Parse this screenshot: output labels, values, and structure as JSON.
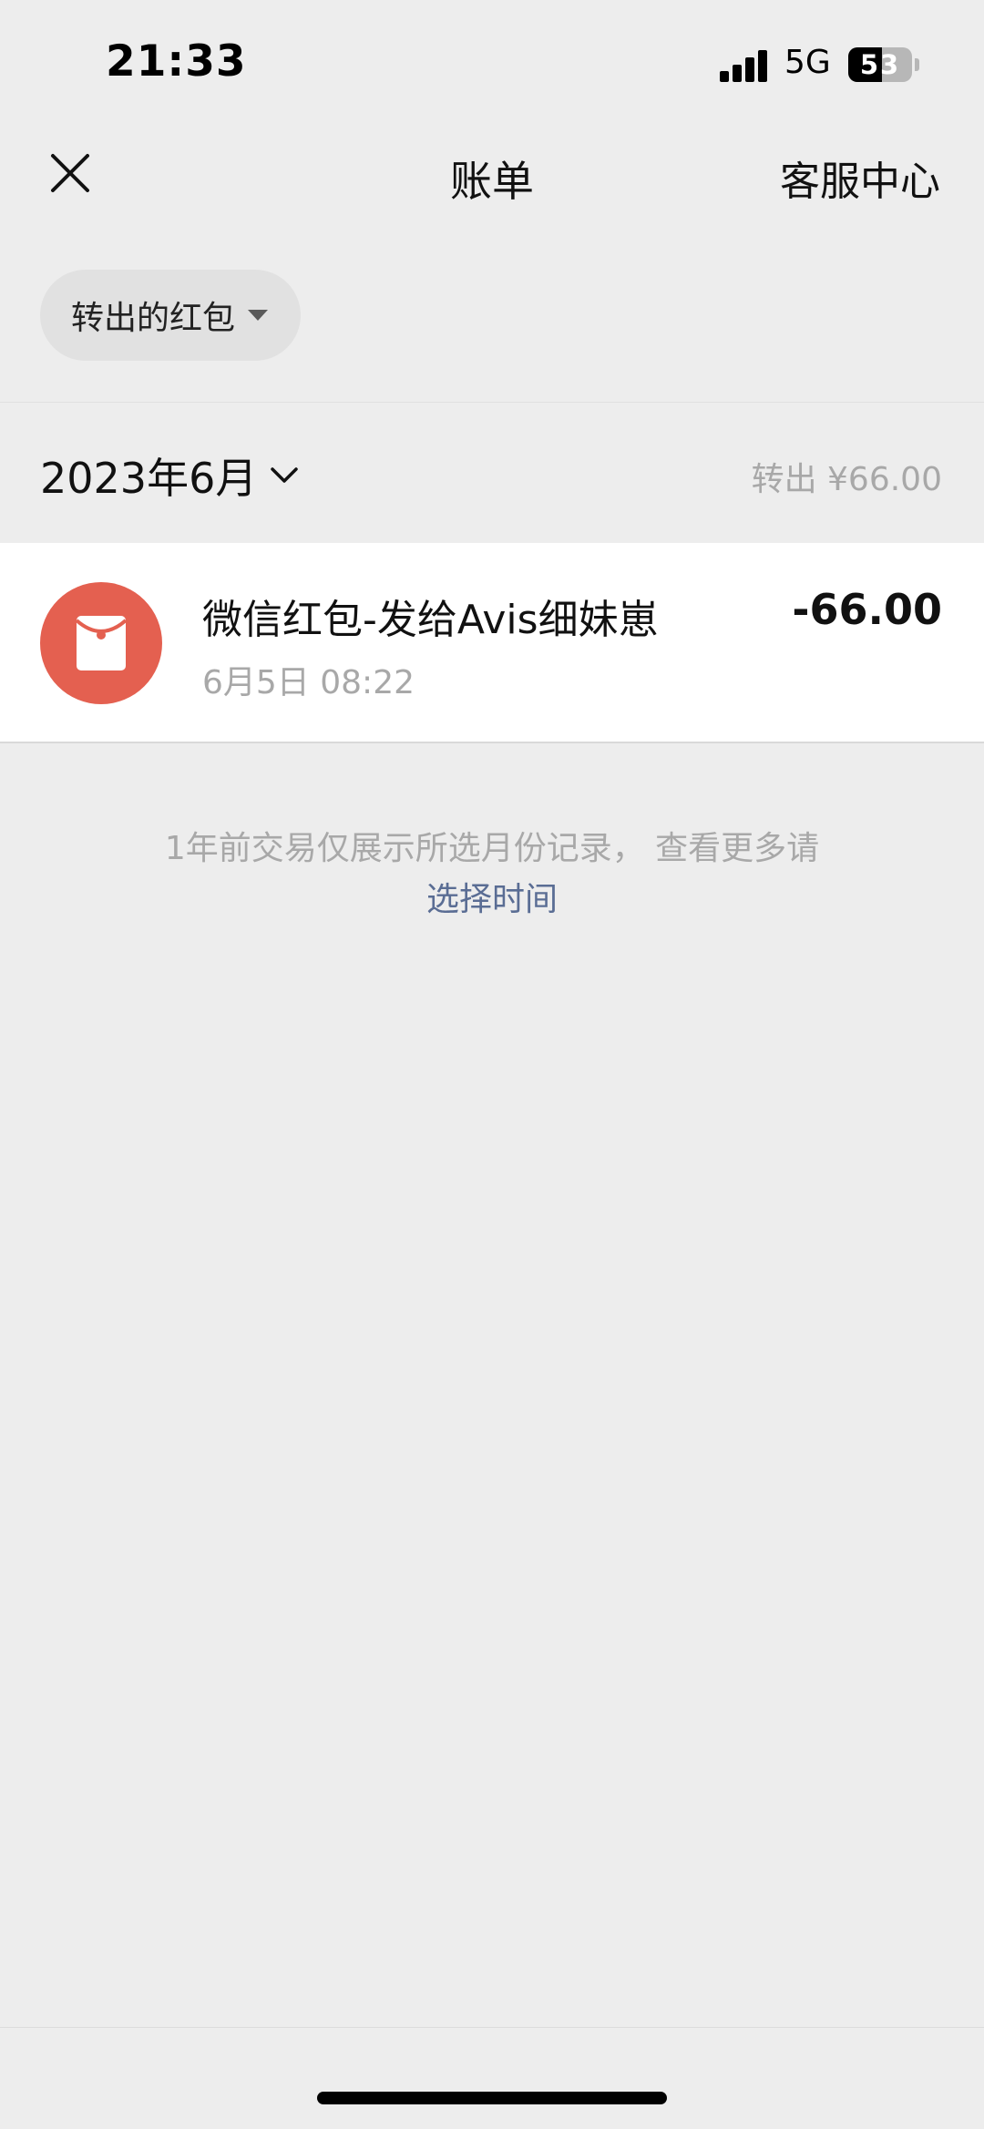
{
  "status_bar": {
    "time": "21:33",
    "network": "5G",
    "battery": "53",
    "battery_level": 0.53
  },
  "nav": {
    "title": "账单",
    "right_label": "客服中心",
    "close_icon": "close-icon"
  },
  "filter": {
    "label": "转出的红包"
  },
  "month": {
    "label": "2023年6月",
    "total": "转出 ¥66.00"
  },
  "transactions": [
    {
      "icon": "red-packet-icon",
      "title": "微信红包-发给Avis细妹崽",
      "time": "6月5日 08:22",
      "amount": "-66.00"
    }
  ],
  "note": {
    "text": "1年前交易仅展示所选月份记录， 查看更多请",
    "link": "选择时间"
  },
  "colors": {
    "background": "#ededed",
    "red_packet": "#e46050",
    "link": "#5a6d94"
  }
}
